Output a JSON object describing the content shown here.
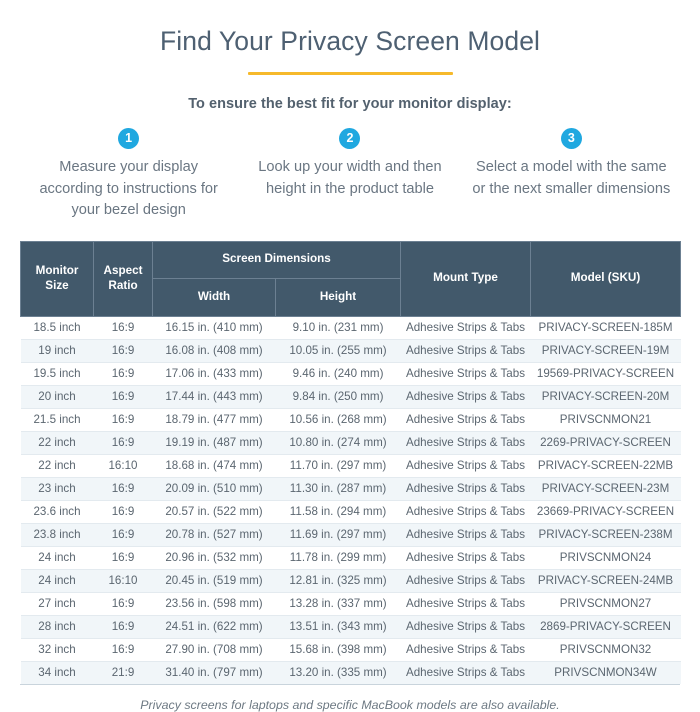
{
  "header": {
    "title": "Find Your Privacy Screen Model",
    "accent_rule_color": "#f6b92b",
    "subtitle": "To ensure the best fit for your monitor display:"
  },
  "steps": [
    {
      "number": "1",
      "text": "Measure your display according to instructions for your bezel design"
    },
    {
      "number": "2",
      "text": "Look up your width and then height in the product table"
    },
    {
      "number": "3",
      "text": "Select a model with the same or the next smaller dimensions"
    }
  ],
  "step_badge_color": "#20a8e0",
  "table": {
    "header_bg": "#42596b",
    "group_headers": {
      "monitor_size": "Monitor Size",
      "aspect_ratio": "Aspect Ratio",
      "screen_dimensions": "Screen Dimensions",
      "width": "Width",
      "height": "Height",
      "mount_type": "Mount Type",
      "model_sku": "Model (SKU)"
    },
    "rows": [
      {
        "size": "18.5 inch",
        "ratio": "16:9",
        "width": "16.15 in. (410 mm)",
        "height": "9.10 in. (231 mm)",
        "mount": "Adhesive Strips & Tabs",
        "model": "PRIVACY-SCREEN-185M"
      },
      {
        "size": "19 inch",
        "ratio": "16:9",
        "width": "16.08 in. (408 mm)",
        "height": "10.05 in. (255 mm)",
        "mount": "Adhesive Strips & Tabs",
        "model": "PRIVACY-SCREEN-19M"
      },
      {
        "size": "19.5 inch",
        "ratio": "16:9",
        "width": "17.06 in. (433 mm)",
        "height": "9.46 in. (240 mm)",
        "mount": "Adhesive Strips & Tabs",
        "model": "19569-PRIVACY-SCREEN"
      },
      {
        "size": "20 inch",
        "ratio": "16:9",
        "width": "17.44 in. (443 mm)",
        "height": "9.84 in. (250 mm)",
        "mount": "Adhesive Strips & Tabs",
        "model": "PRIVACY-SCREEN-20M"
      },
      {
        "size": "21.5 inch",
        "ratio": "16:9",
        "width": "18.79 in. (477 mm)",
        "height": "10.56 in. (268 mm)",
        "mount": "Adhesive Strips & Tabs",
        "model": "PRIVSCNMON21"
      },
      {
        "size": "22 inch",
        "ratio": "16:9",
        "width": "19.19 in. (487 mm)",
        "height": "10.80 in. (274 mm)",
        "mount": "Adhesive Strips & Tabs",
        "model": "2269-PRIVACY-SCREEN"
      },
      {
        "size": "22 inch",
        "ratio": "16:10",
        "width": "18.68 in. (474 mm)",
        "height": "11.70 in. (297 mm)",
        "mount": "Adhesive Strips & Tabs",
        "model": "PRIVACY-SCREEN-22MB"
      },
      {
        "size": "23 inch",
        "ratio": "16:9",
        "width": "20.09 in. (510 mm)",
        "height": "11.30 in. (287 mm)",
        "mount": "Adhesive Strips & Tabs",
        "model": "PRIVACY-SCREEN-23M"
      },
      {
        "size": "23.6 inch",
        "ratio": "16:9",
        "width": "20.57 in. (522 mm)",
        "height": "11.58 in. (294 mm)",
        "mount": "Adhesive Strips & Tabs",
        "model": "23669-PRIVACY-SCREEN"
      },
      {
        "size": "23.8 inch",
        "ratio": "16:9",
        "width": "20.78 in. (527 mm)",
        "height": "11.69 in. (297 mm)",
        "mount": "Adhesive Strips & Tabs",
        "model": "PRIVACY-SCREEN-238M"
      },
      {
        "size": "24 inch",
        "ratio": "16:9",
        "width": "20.96 in. (532 mm)",
        "height": "11.78 in. (299 mm)",
        "mount": "Adhesive Strips & Tabs",
        "model": "PRIVSCNMON24"
      },
      {
        "size": "24 inch",
        "ratio": "16:10",
        "width": "20.45 in. (519 mm)",
        "height": "12.81 in. (325 mm)",
        "mount": "Adhesive Strips & Tabs",
        "model": "PRIVACY-SCREEN-24MB"
      },
      {
        "size": "27 inch",
        "ratio": "16:9",
        "width": "23.56 in. (598 mm)",
        "height": "13.28 in. (337 mm)",
        "mount": "Adhesive Strips & Tabs",
        "model": "PRIVSCNMON27"
      },
      {
        "size": "28 inch",
        "ratio": "16:9",
        "width": "24.51 in. (622 mm)",
        "height": "13.51 in. (343 mm)",
        "mount": "Adhesive Strips & Tabs",
        "model": "2869-PRIVACY-SCREEN"
      },
      {
        "size": "32 inch",
        "ratio": "16:9",
        "width": "27.90 in. (708 mm)",
        "height": "15.68 in. (398 mm)",
        "mount": "Adhesive Strips & Tabs",
        "model": "PRIVSCNMON32"
      },
      {
        "size": "34 inch",
        "ratio": "21:9",
        "width": "31.40 in. (797 mm)",
        "height": "13.20 in. (335 mm)",
        "mount": "Adhesive Strips & Tabs",
        "model": "PRIVSCNMON34W"
      }
    ]
  },
  "footer": {
    "note": "Privacy screens for laptops and specific MacBook models are also available."
  }
}
